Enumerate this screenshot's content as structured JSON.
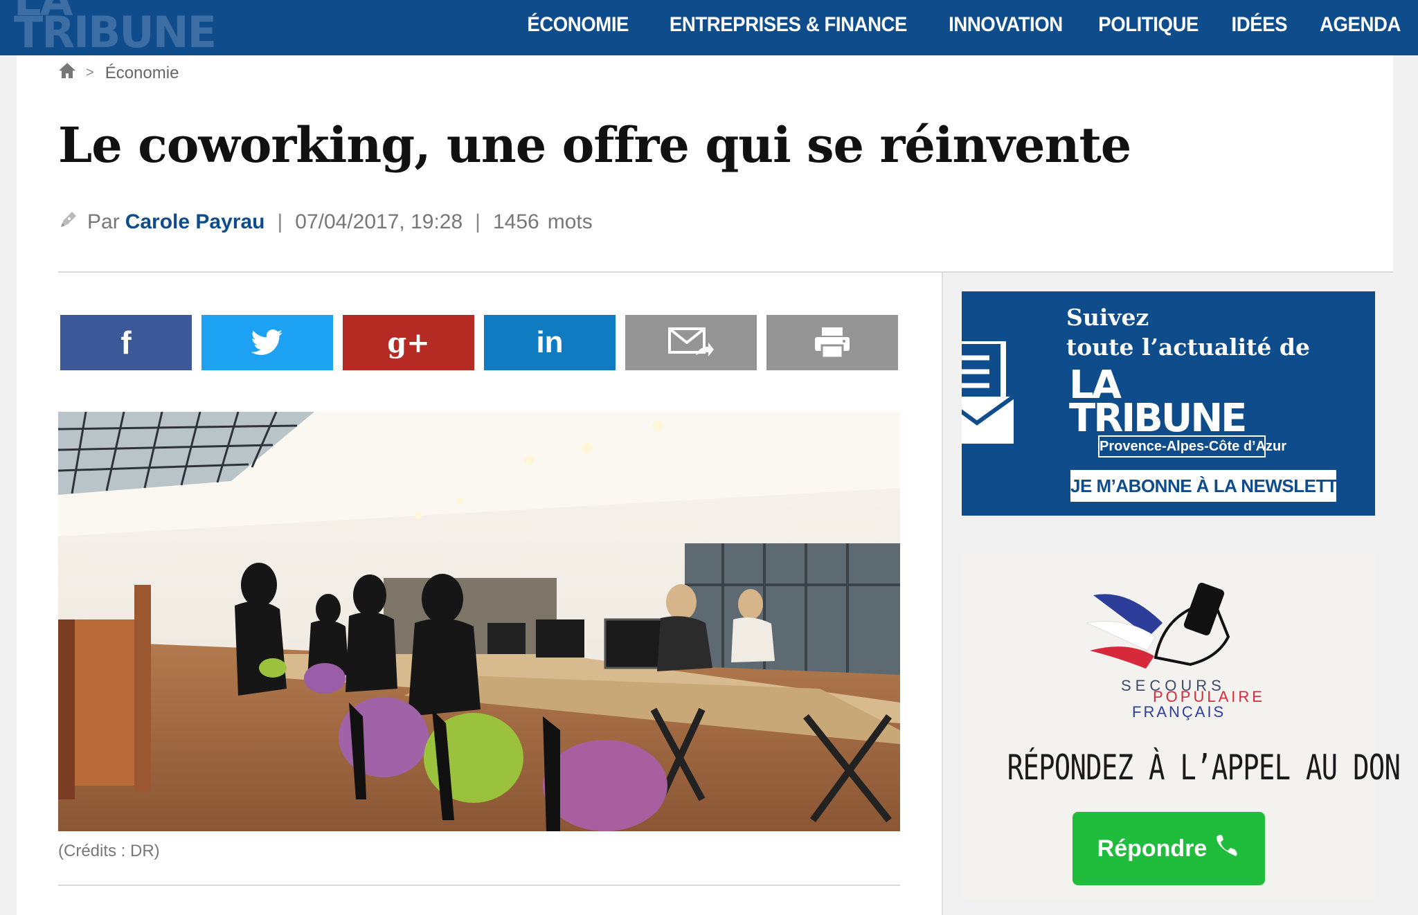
{
  "header": {
    "logo_line1": "LA",
    "logo_line2": "TRIBUNE",
    "nav": [
      "ÉCONOMIE",
      "ENTREPRISES & FINANCE",
      "INNOVATION",
      "POLITIQUE",
      "IDÉES",
      "AGENDA"
    ]
  },
  "breadcrumb": {
    "section": "Économie",
    "separator": ">"
  },
  "article": {
    "title": "Le coworking, une offre qui se réinvente",
    "by_prefix": "Par",
    "author": "Carole Payrau",
    "date": "07/04/2017, 19:28",
    "word_count": "1456",
    "word_label": "mots",
    "pipe": "|",
    "photo_credit": "(Crédits : DR)"
  },
  "share": {
    "facebook": "f",
    "googleplus": "g+",
    "linkedin": "in"
  },
  "ads": {
    "newsletter": {
      "line1": "Suivez",
      "line2": "toute l’actualité de",
      "brand1": "LA",
      "brand2": "TRIBUNE",
      "region": "Provence-Alpes-Côte d’Azur",
      "cta": "JE M’ABONNE À LA NEWSLETTER"
    },
    "donation": {
      "org1": "SECOURS",
      "org2": "POPULAIRE",
      "org3": "FRANÇAIS",
      "appeal": "RÉPONDEZ À L’APPEL AU DON",
      "button": "Répondre"
    }
  },
  "colors": {
    "brand_blue": "#0e4c8b",
    "facebook": "#3b5998",
    "twitter": "#1da1f2",
    "googleplus": "#b52a22",
    "linkedin": "#0f7bc1",
    "grey_button": "#959595",
    "donate_green": "#20bd3d"
  },
  "icons": [
    "home-icon",
    "pen-icon",
    "facebook-icon",
    "twitter-icon",
    "googleplus-icon",
    "linkedin-icon",
    "mail-forward-icon",
    "printer-icon",
    "newsletter-doc-icon",
    "phone-icon",
    "wing-hand-logo"
  ]
}
